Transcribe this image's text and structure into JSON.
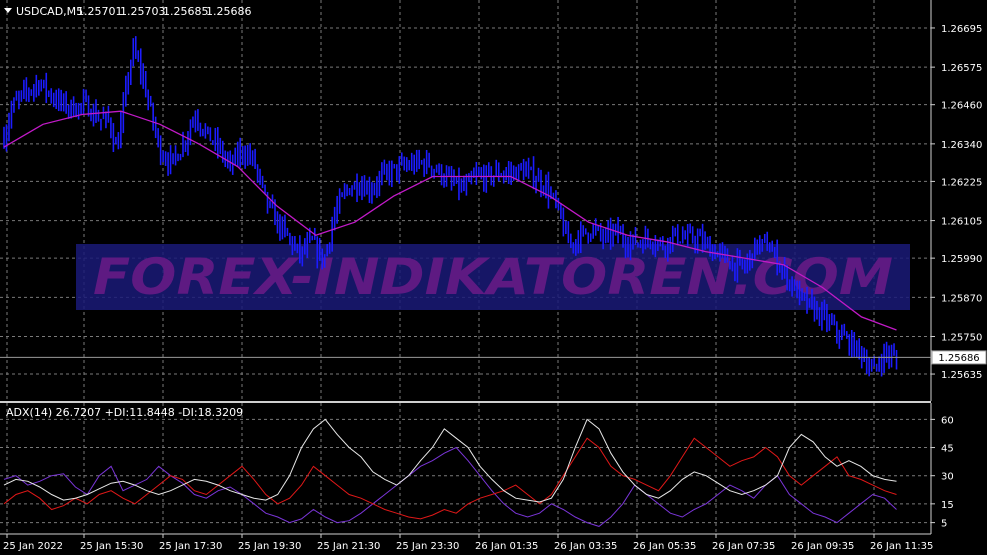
{
  "main_window": {
    "symbol_label": "USDCAD,M5",
    "ohlc": [
      "1.25701",
      "1.25703",
      "1.25685",
      "1.25686"
    ],
    "current_price_label": "1.25686",
    "watermark": "FOREX-INDIKATOREN.COM",
    "colors": {
      "background": "#000000",
      "grid": "#7a7a7a",
      "bars": "#1c1cff",
      "moving_average": "#c21ac8",
      "watermark_text": "#6a1a8c",
      "watermark_band": "#1a1a78",
      "text": "#ffffff",
      "price_line": "#9a9a9a"
    }
  },
  "indicator_window": {
    "label": "ADX(14) 26.7207 +DI:11.8448 -DI:18.3209",
    "colors": {
      "adx": "#e8e8e8",
      "plus_di": "#7a35d8",
      "minus_di": "#e01818"
    }
  },
  "time_axis": {
    "labels": [
      "25 Jan 2022",
      "25 Jan 15:30",
      "25 Jan 17:30",
      "25 Jan 19:30",
      "25 Jan 21:30",
      "25 Jan 23:30",
      "26 Jan 01:35",
      "26 Jan 03:35",
      "26 Jan 05:35",
      "26 Jan 07:35",
      "26 Jan 09:35",
      "26 Jan 11:35"
    ]
  },
  "chart_data": [
    {
      "type": "line",
      "title": "USDCAD,M5",
      "ylim": [
        1.2558,
        1.2675
      ],
      "y_ticks": [
        "1.26695",
        "1.26575",
        "1.26460",
        "1.26340",
        "1.26225",
        "1.26105",
        "1.25990",
        "1.25870",
        "1.25750",
        "1.25635"
      ],
      "x_ticks": [
        "25 Jan 2022",
        "25 Jan 15:30",
        "25 Jan 17:30",
        "25 Jan 19:30",
        "25 Jan 21:30",
        "25 Jan 23:30",
        "26 Jan 01:35",
        "26 Jan 03:35",
        "26 Jan 05:35",
        "26 Jan 07:35",
        "26 Jan 09:35",
        "26 Jan 11:35"
      ],
      "x_range": [
        0,
        11.7
      ],
      "grid": true,
      "price_line": 1.25686,
      "series": [
        {
          "kind": "bars",
          "points": [
            [
              0.0,
              1.2636
            ],
            [
              0.1,
              1.2645
            ],
            [
              0.2,
              1.2648
            ],
            [
              0.3,
              1.265
            ],
            [
              0.45,
              1.2653
            ],
            [
              0.6,
              1.2649
            ],
            [
              0.75,
              1.2646
            ],
            [
              0.9,
              1.2645
            ],
            [
              1.05,
              1.2646
            ],
            [
              1.2,
              1.2642
            ],
            [
              1.35,
              1.2641
            ],
            [
              1.45,
              1.2632
            ],
            [
              1.55,
              1.2648
            ],
            [
              1.65,
              1.2663
            ],
            [
              1.75,
              1.2657
            ],
            [
              1.85,
              1.2647
            ],
            [
              2.0,
              1.2632
            ],
            [
              2.15,
              1.2628
            ],
            [
              2.3,
              1.2634
            ],
            [
              2.45,
              1.2643
            ],
            [
              2.6,
              1.2637
            ],
            [
              2.75,
              1.2633
            ],
            [
              2.9,
              1.2627
            ],
            [
              3.05,
              1.2632
            ],
            [
              3.2,
              1.2629
            ],
            [
              3.35,
              1.2617
            ],
            [
              3.5,
              1.261
            ],
            [
              3.65,
              1.2605
            ],
            [
              3.8,
              1.26
            ],
            [
              3.95,
              1.2604
            ],
            [
              4.1,
              1.2598
            ],
            [
              4.25,
              1.2613
            ],
            [
              4.4,
              1.262
            ],
            [
              4.55,
              1.2622
            ],
            [
              4.7,
              1.262
            ],
            [
              4.85,
              1.2624
            ],
            [
              5.0,
              1.2626
            ],
            [
              5.15,
              1.2627
            ],
            [
              5.3,
              1.2628
            ],
            [
              5.45,
              1.2628
            ],
            [
              5.6,
              1.2625
            ],
            [
              5.75,
              1.2622
            ],
            [
              5.9,
              1.262
            ],
            [
              6.05,
              1.2624
            ],
            [
              6.2,
              1.2624
            ],
            [
              6.35,
              1.2625
            ],
            [
              6.5,
              1.2625
            ],
            [
              6.65,
              1.2626
            ],
            [
              6.8,
              1.2624
            ],
            [
              6.95,
              1.2621
            ],
            [
              7.1,
              1.2614
            ],
            [
              7.25,
              1.2603
            ],
            [
              7.4,
              1.2606
            ],
            [
              7.55,
              1.2608
            ],
            [
              7.7,
              1.2605
            ],
            [
              7.85,
              1.2607
            ],
            [
              8.0,
              1.2604
            ],
            [
              8.15,
              1.2604
            ],
            [
              8.3,
              1.2605
            ],
            [
              8.45,
              1.2603
            ],
            [
              8.6,
              1.2606
            ],
            [
              8.75,
              1.2605
            ],
            [
              8.9,
              1.2605
            ],
            [
              9.05,
              1.2602
            ],
            [
              9.2,
              1.26
            ],
            [
              9.35,
              1.2597
            ],
            [
              9.5,
              1.2596
            ],
            [
              9.65,
              1.2603
            ],
            [
              9.8,
              1.2603
            ],
            [
              9.95,
              1.2597
            ],
            [
              10.1,
              1.2591
            ],
            [
              10.25,
              1.2586
            ],
            [
              10.4,
              1.2583
            ],
            [
              10.55,
              1.258
            ],
            [
              10.7,
              1.2576
            ],
            [
              10.85,
              1.2573
            ],
            [
              11.0,
              1.257
            ],
            [
              11.15,
              1.2564
            ],
            [
              11.3,
              1.257
            ],
            [
              11.45,
              1.2568
            ]
          ]
        },
        {
          "kind": "moving-average",
          "points": [
            [
              0.0,
              1.2633
            ],
            [
              0.5,
              1.264
            ],
            [
              1.0,
              1.2643
            ],
            [
              1.5,
              1.2644
            ],
            [
              2.0,
              1.264
            ],
            [
              2.5,
              1.2634
            ],
            [
              3.0,
              1.2627
            ],
            [
              3.5,
              1.2615
            ],
            [
              4.0,
              1.2606
            ],
            [
              4.5,
              1.261
            ],
            [
              5.0,
              1.2618
            ],
            [
              5.5,
              1.2624
            ],
            [
              6.0,
              1.2624
            ],
            [
              6.5,
              1.2624
            ],
            [
              7.0,
              1.2618
            ],
            [
              7.5,
              1.261
            ],
            [
              8.0,
              1.2606
            ],
            [
              8.5,
              1.2604
            ],
            [
              9.0,
              1.2601
            ],
            [
              9.5,
              1.2599
            ],
            [
              10.0,
              1.2597
            ],
            [
              10.5,
              1.259
            ],
            [
              11.0,
              1.2581
            ],
            [
              11.45,
              1.2577
            ]
          ]
        }
      ]
    },
    {
      "type": "line",
      "title": "ADX(14) 26.7207 +DI:11.8448 -DI:18.3209",
      "ylim": [
        0,
        65
      ],
      "y_ticks": [
        "60",
        "45",
        "30",
        "15",
        "5"
      ],
      "y_tick_values": [
        60,
        45,
        30,
        15,
        5
      ],
      "x_range": [
        0,
        11.7
      ],
      "grid": true,
      "series": [
        {
          "name": "ADX",
          "values": [
            25,
            28,
            27,
            24,
            20,
            17,
            18,
            20,
            23,
            26,
            27,
            25,
            22,
            20,
            22,
            25,
            28,
            27,
            25,
            22,
            20,
            18,
            17,
            20,
            30,
            45,
            55,
            60,
            52,
            45,
            40,
            32,
            28,
            25,
            30,
            38,
            45,
            55,
            50,
            45,
            35,
            28,
            22,
            18,
            17,
            16,
            18,
            28,
            45,
            60,
            55,
            42,
            32,
            25,
            20,
            18,
            22,
            28,
            32,
            30,
            26,
            22,
            20,
            22,
            25,
            30,
            45,
            52,
            48,
            40,
            35,
            38,
            35,
            30,
            28,
            27
          ]
        },
        {
          "name": "+DI",
          "values": [
            28,
            30,
            25,
            27,
            30,
            31,
            24,
            20,
            30,
            35,
            22,
            25,
            28,
            35,
            30,
            26,
            20,
            18,
            22,
            24,
            20,
            15,
            10,
            8,
            5,
            7,
            12,
            8,
            5,
            6,
            10,
            15,
            20,
            25,
            30,
            35,
            38,
            42,
            45,
            38,
            30,
            22,
            15,
            10,
            8,
            10,
            15,
            12,
            8,
            5,
            3,
            8,
            15,
            25,
            20,
            15,
            10,
            8,
            12,
            15,
            20,
            25,
            22,
            18,
            25,
            30,
            20,
            15,
            10,
            8,
            5,
            10,
            15,
            20,
            18,
            12
          ]
        },
        {
          "name": "-DI",
          "values": [
            15,
            20,
            22,
            18,
            12,
            14,
            18,
            15,
            20,
            22,
            18,
            15,
            20,
            25,
            30,
            28,
            22,
            20,
            25,
            30,
            35,
            28,
            20,
            15,
            18,
            25,
            35,
            30,
            25,
            20,
            18,
            15,
            12,
            10,
            8,
            7,
            9,
            12,
            10,
            15,
            18,
            20,
            22,
            25,
            20,
            15,
            20,
            30,
            40,
            50,
            45,
            35,
            30,
            28,
            25,
            22,
            30,
            40,
            50,
            45,
            40,
            35,
            38,
            40,
            45,
            40,
            30,
            25,
            30,
            35,
            40,
            30,
            28,
            25,
            22,
            20
          ]
        }
      ]
    }
  ]
}
